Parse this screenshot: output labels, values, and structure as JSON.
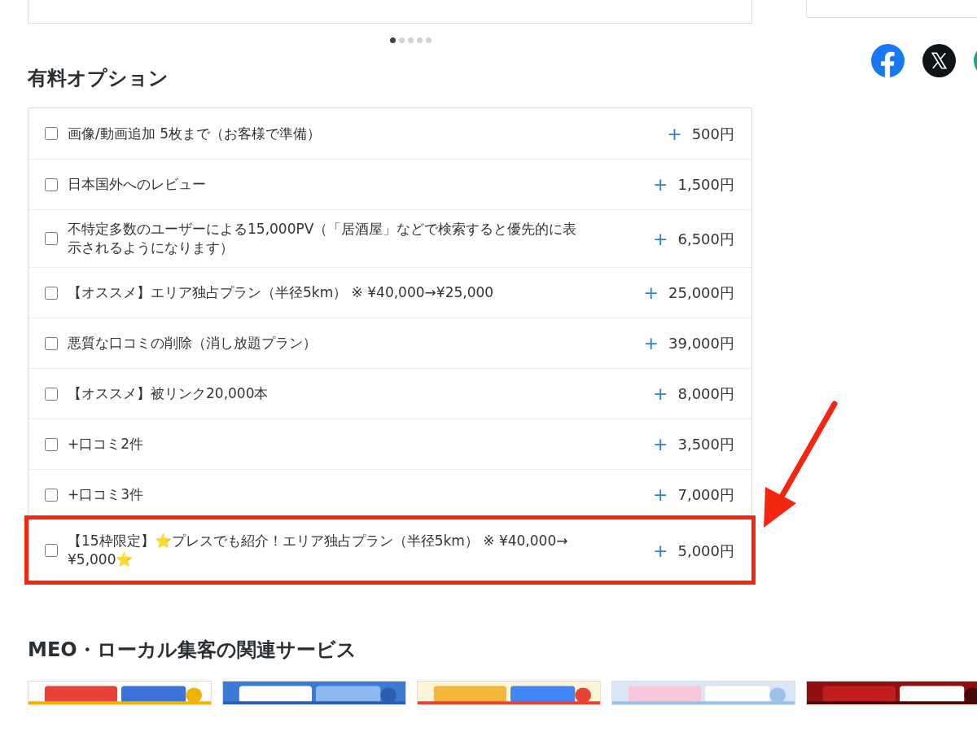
{
  "carousel": {
    "dots": [
      {
        "selected": true
      },
      {
        "selected": false
      },
      {
        "selected": false
      },
      {
        "selected": false
      },
      {
        "selected": false
      }
    ]
  },
  "options_title": "有料オプション",
  "options": [
    {
      "label": "画像/動画追加 5枚まで（お客様で準備）",
      "plus": "+",
      "price": "500円",
      "checked": false,
      "highlighted": false
    },
    {
      "label": "日本国外へのレビュー",
      "plus": "+",
      "price": "1,500円",
      "checked": false,
      "highlighted": false
    },
    {
      "label": "不特定多数のユーザーによる15,000PV（「居酒屋」などで検索すると優先的に表示されるようになります）",
      "plus": "+",
      "price": "6,500円",
      "checked": false,
      "highlighted": false
    },
    {
      "label": "【オススメ】エリア独占プラン（半径5km） ※ ¥40,000→¥25,000",
      "plus": "+",
      "price": "25,000円",
      "checked": false,
      "highlighted": false
    },
    {
      "label": "悪質な口コミの削除（消し放題プラン）",
      "plus": "+",
      "price": "39,000円",
      "checked": false,
      "highlighted": false
    },
    {
      "label": "【オススメ】被リンク20,000本",
      "plus": "+",
      "price": "8,000円",
      "checked": false,
      "highlighted": false
    },
    {
      "label": "+口コミ2件",
      "plus": "+",
      "price": "3,500円",
      "checked": false,
      "highlighted": false
    },
    {
      "label": "+口コミ3件",
      "plus": "+",
      "price": "7,000円",
      "checked": false,
      "highlighted": false
    },
    {
      "label": "【15枠限定】⭐プレスでも紹介！エリア独占プラン（半径5km） ※ ¥40,000→¥5,000⭐",
      "plus": "+",
      "price": "5,000円",
      "checked": false,
      "highlighted": true
    }
  ],
  "related_title": "MEO・ローカル集客の関連サービス"
}
